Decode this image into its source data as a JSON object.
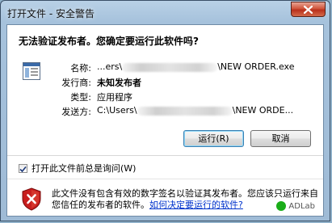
{
  "window": {
    "title": "打开文件 - 安全警告",
    "close_icon": "close-icon"
  },
  "dialog": {
    "question": "无法验证发布者。您确定要运行此软件吗?",
    "fields": {
      "name_label": "名称:",
      "name_prefix": "...ers\\",
      "name_suffix": "\\NEW ORDER.exe",
      "publisher_label": "发行商:",
      "publisher_value": "未知发布者",
      "type_label": "类型:",
      "type_value": "应用程序",
      "from_label": "发送方:",
      "from_prefix": "C:\\Users\\",
      "from_suffix": "\\NEW ORDE..."
    },
    "buttons": {
      "run": "运行(R)",
      "cancel": "取消"
    },
    "checkbox": {
      "label": "打开此文件前总是询问(W)",
      "checked": true
    },
    "warning": {
      "text": "此文件没有包含有效的数字签名以验证其发布者。您应该只运行来自您信任的发布者的软件。",
      "link": "如何决定要运行的软件?"
    },
    "watermark": "ADLab"
  },
  "colors": {
    "titlebar": "#a6c2dc",
    "close_button": "#c84a30",
    "link": "#0033cc",
    "shield": "#c81e1e"
  }
}
